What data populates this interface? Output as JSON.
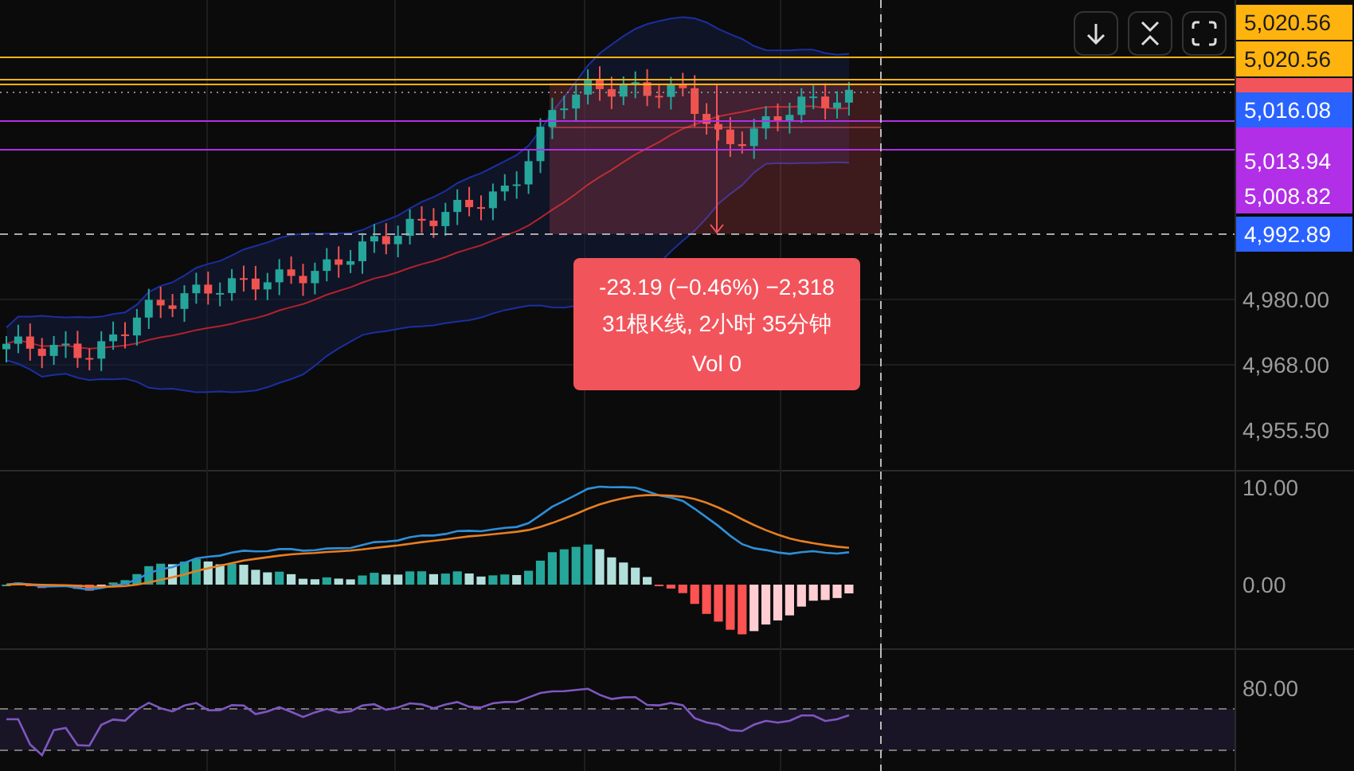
{
  "price_axis": {
    "ticks": [
      "4,980.00",
      "4,968.00",
      "4,955.50"
    ],
    "labels": [
      {
        "text": "5,020.56",
        "color": "#ffb30f"
      },
      {
        "text": "5,020.56",
        "color": "#ffb30f"
      },
      {
        "text": "5,016.08",
        "color": "#2962ff"
      },
      {
        "text": "5,013.94",
        "color": "#b12fe6"
      },
      {
        "text": "5,008.82",
        "color": "#b12fe6"
      },
      {
        "text": "4,992.89",
        "color": "#2962ff"
      }
    ]
  },
  "macd_axis": {
    "ticks": [
      "10.00",
      "0.00"
    ]
  },
  "rsi_axis": {
    "ticks": [
      "80.00"
    ]
  },
  "measure_tooltip": {
    "lines": [
      "-23.19 (−0.46%) −2,318",
      "31根K线, 2小时 35分钟",
      "Vol 0"
    ]
  }
}
